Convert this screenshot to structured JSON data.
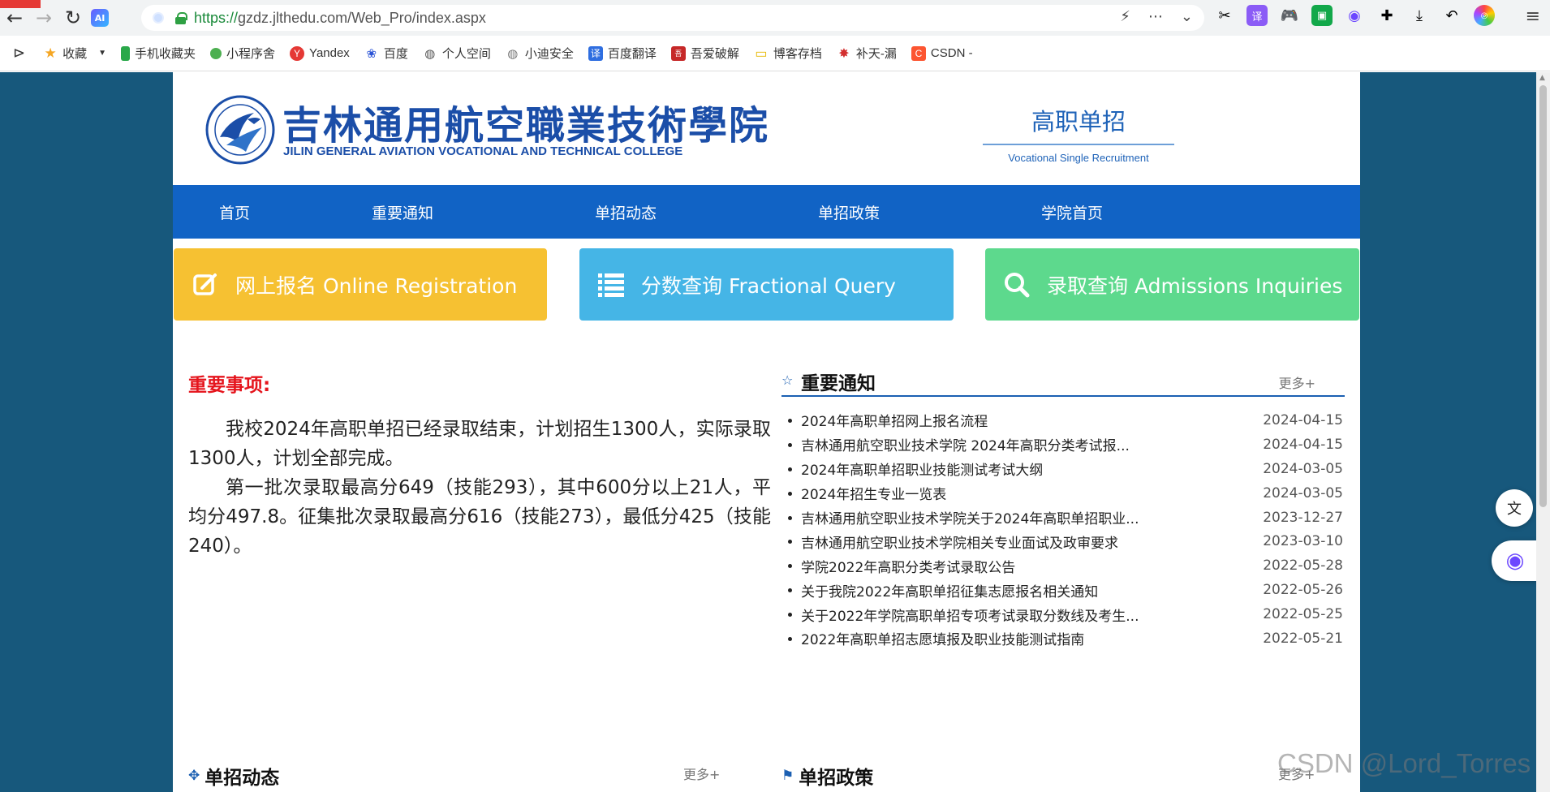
{
  "browser": {
    "url_scheme": "https://",
    "url_rest": "gzdz.jlthedu.com/Web_Pro/index.aspx",
    "ai_label": "AI",
    "bookmarks": [
      {
        "label": "收藏",
        "icon": "star-icon"
      },
      {
        "label": "手机收藏夹",
        "icon": "phone-icon"
      },
      {
        "label": "小程序舍",
        "icon": "miniapp-icon"
      },
      {
        "label": "Yandex",
        "icon": "yandex-icon"
      },
      {
        "label": "百度",
        "icon": "baidu-icon"
      },
      {
        "label": "个人空间",
        "icon": "globe-icon"
      },
      {
        "label": "小迪安全",
        "icon": "globe-icon"
      },
      {
        "label": "百度翻译",
        "icon": "translate-icon"
      },
      {
        "label": "吾爱破解",
        "icon": "52pojie-icon"
      },
      {
        "label": "博客存档",
        "icon": "folder-icon"
      },
      {
        "label": "补天-漏",
        "icon": "butian-icon"
      },
      {
        "label": "CSDN -",
        "icon": "csdn-icon"
      }
    ]
  },
  "header": {
    "school_cn": "吉林通用航空職業技術學院",
    "school_en": "JILIN GENERAL AVIATION VOCATIONAL AND TECHNICAL COLLEGE",
    "recruit_cn": "高职单招",
    "recruit_en": "Vocational Single Recruitment"
  },
  "nav": [
    "首页",
    "重要通知",
    "单招动态",
    "单招政策",
    "学院首页"
  ],
  "quick": [
    {
      "label": "网上报名 Online Registration",
      "color": "#f6c132",
      "icon": "edit-icon"
    },
    {
      "label": "分数查询 Fractional Query",
      "color": "#45b5e6",
      "icon": "list-icon"
    },
    {
      "label": "录取查询 Admissions Inquiries",
      "color": "#5dd98d",
      "icon": "search-icon"
    }
  ],
  "notice": {
    "title": "重要事项:",
    "p1": "我校2024年高职单招已经录取结束，计划招生1300人，实际录取1300人，计划全部完成。",
    "p2": "第一批次录取最高分649（技能293），其中600分以上21人，平均分497.8。征集批次录取最高分616（技能273），最低分425（技能240）。"
  },
  "news": {
    "title": "重要通知",
    "more": "更多+",
    "items": [
      {
        "title": "2024年高职单招网上报名流程",
        "date": "2024-04-15"
      },
      {
        "title": "吉林通用航空职业技术学院 2024年高职分类考试报...",
        "date": "2024-04-15"
      },
      {
        "title": "2024年高职单招职业技能测试考试大纲",
        "date": "2024-03-05"
      },
      {
        "title": "2024年招生专业一览表",
        "date": "2024-03-05"
      },
      {
        "title": "吉林通用航空职业技术学院关于2024年高职单招职业...",
        "date": "2023-12-27"
      },
      {
        "title": "吉林通用航空职业技术学院相关专业面试及政审要求",
        "date": "2023-03-10"
      },
      {
        "title": "学院2022年高职分类考试录取公告",
        "date": "2022-05-28"
      },
      {
        "title": "关于我院2022年高职单招征集志愿报名相关通知",
        "date": "2022-05-26"
      },
      {
        "title": "关于2022年学院高职单招专项考试录取分数线及考生...",
        "date": "2022-05-25"
      },
      {
        "title": "2022年高职单招志愿填报及职业技能测试指南",
        "date": "2022-05-21"
      }
    ]
  },
  "sections": {
    "dynamics": "单招动态",
    "dynamics_more": "更多+",
    "policy": "单招政策",
    "policy_more": "更多+"
  },
  "watermark": "CSDN @Lord_Torres",
  "colors": {
    "nav": "#1163c5",
    "page_bg": "#17587c",
    "notice_title": "#e5141c",
    "brand": "#1b4ea8"
  }
}
